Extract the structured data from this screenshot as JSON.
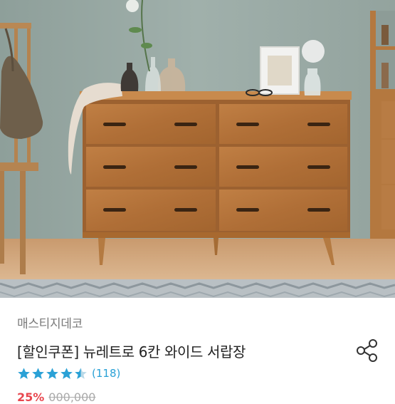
{
  "product": {
    "brand": "매스티지데코",
    "title": "[할인쿠폰] 뉴레트로 6칸 와이드 서랍장",
    "rating": 4.5,
    "review_count": "(118)",
    "discount": "25%",
    "original_price": "000,000"
  },
  "icons": {
    "share": "share-icon",
    "star": "star-icon"
  },
  "colors": {
    "star": "#2aa1d6",
    "review_count": "#2aa1d6",
    "wall": "#93a49f",
    "wood": "#b5753c"
  }
}
